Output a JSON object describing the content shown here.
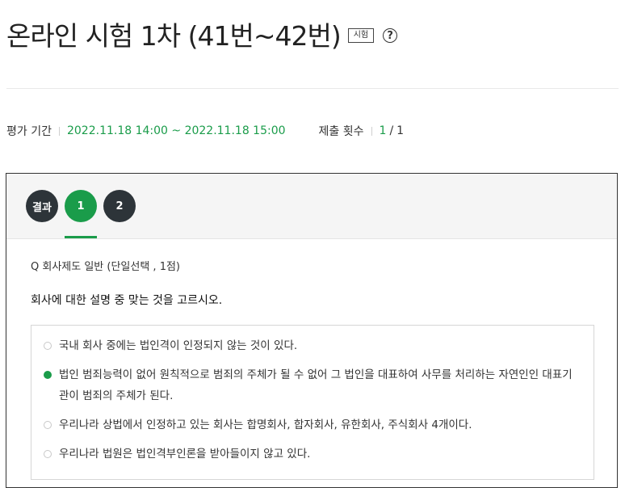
{
  "header": {
    "title": "온라인 시험 1차 (41번~42번)",
    "badge": "시험",
    "help_glyph": "?"
  },
  "meta": {
    "period_label": "평가 기간",
    "period_value": "2022.11.18 14:00 ~ 2022.11.18 15:00",
    "submit_label": "제출 횟수",
    "submit_count": "1",
    "submit_slash": "/",
    "submit_total": "1"
  },
  "tabs": [
    {
      "label": "결과",
      "active": false
    },
    {
      "label": "1",
      "active": true
    },
    {
      "label": "2",
      "active": false
    }
  ],
  "question": {
    "header": "Q  회사제도 일반 (단일선택 , 1점)",
    "text": "회사에 대한 설명 중 맞는 것을 고르시오.",
    "options": [
      {
        "text": "국내 회사 중에는 법인격이 인정되지 않는 것이 있다.",
        "selected": false
      },
      {
        "text": "법인 범죄능력이 없어 원칙적으로 범죄의 주체가 될 수 없어 그 법인을 대표하여 사무를 처리하는 자연인인 대표기관이 범죄의 주체가 된다.",
        "selected": true
      },
      {
        "text": "우리나라 상법에서 인정하고 있는 회사는 합명회사, 합자회사, 유한회사, 주식회사 4개이다.",
        "selected": false
      },
      {
        "text": "우리나라 법원은 법인격부인론을 받아들이지 않고 있다.",
        "selected": false
      }
    ]
  },
  "colors": {
    "accent": "#1a9c4a",
    "tab_dark": "#2d3439"
  }
}
